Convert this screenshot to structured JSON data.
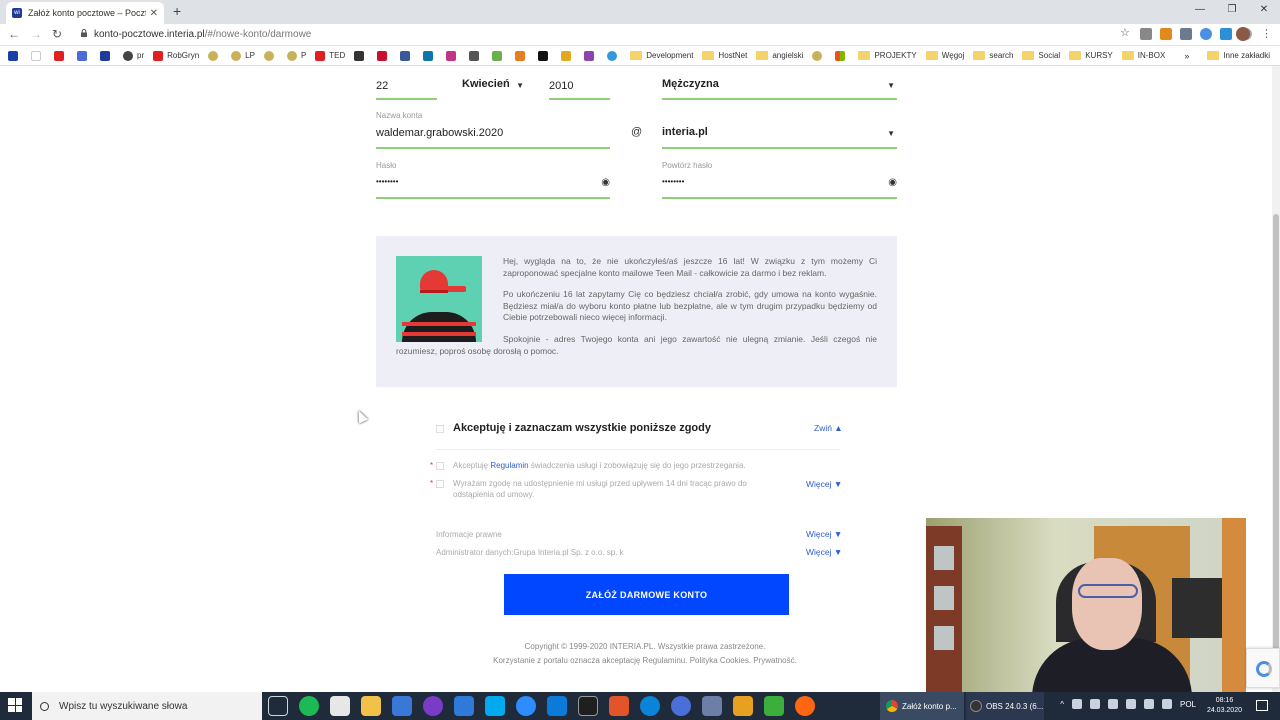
{
  "browser": {
    "tab_title": "Załóż konto pocztowe – Poczta w",
    "url_main": "konto-pocztowe.interia.pl",
    "url_path": "/#/nowe-konto/darmowe",
    "bookmarks": [
      "",
      "",
      "",
      "",
      "",
      "pr",
      "RobGryn",
      "",
      "LP",
      "",
      "P",
      "TED",
      "",
      "",
      "",
      "",
      "",
      "",
      "",
      "",
      "",
      "",
      "",
      ""
    ],
    "bookmark_folders": [
      "Development",
      "HostNet",
      "angielski",
      "",
      "PROJEKTY",
      "Węgoj",
      "search",
      "Social",
      "KURSY",
      "IN-BOX"
    ],
    "bookmarks_more": "»",
    "other_bookmarks": "Inne zakładki"
  },
  "form": {
    "day": "22",
    "month": "Kwiecień",
    "year": "2010",
    "gender": "Mężczyzna",
    "account_label": "Nazwa konta",
    "account_value": "waldemar.grabowski.2020",
    "at_sign": "@",
    "domain": "interia.pl",
    "password_label": "Hasło",
    "password_value": "••••••••",
    "repeat_label": "Powtórz hasło",
    "repeat_value": "••••••••"
  },
  "teen_notice": {
    "p1": "Hej, wygląda na to, że nie ukończyłeś/aś jeszcze 16 lat! W związku z tym możemy Ci zaproponować specjalne konto mailowe Teen Mail - całkowicie za darmo i bez reklam.",
    "p2": "Po ukończeniu 16 lat zapytamy Cię co będziesz chciał/a zrobić, gdy umowa na konto wygaśnie. Będziesz miał/a do wyboru konto płatne lub bezpłatne, ale w tym drugim przypadku będziemy od Ciebie potrzebowali nieco więcej informacji.",
    "p3": "Spokojnie - adres Twojego konta ani jego zawartość nie ulegną zmianie. Jeśli czegoś nie rozumiesz, poproś osobę dorosłą o pomoc."
  },
  "consents": {
    "accept_all": "Akceptuję i zaznaczam wszystkie poniższe zgody",
    "collapse": "Zwiń ▲",
    "req_mark": "*",
    "c1_pre": "Akceptuję ",
    "c1_link": "Regulamin",
    "c1_post": " świadczenia usługi i zobowiązuję się do jego przestrzegania.",
    "c2": "Wyrażam zgodę na udostępnienie mi usługi przed upływem 14 dni tracąc prawo do odstąpienia od umowy.",
    "more": "Więcej ▼",
    "legal_info": "Informacje prawne",
    "admin": "Administrator danych:Grupa Interia.pl Sp. z o.o. sp. k"
  },
  "submit_label": "ZAŁÓŻ DARMOWE KONTO",
  "footer": {
    "copyright": "Copyright © 1999-2020 INTERIA.PL. Wszystkie prawa zastrzeżone.",
    "terms": "Korzystanie z portalu oznacza akceptację Regulaminu. Polityka Cookies. Prywatność."
  },
  "taskbar": {
    "search_placeholder": "Wpisz tu wyszukiwane słowa",
    "chrome_item": "Załóż konto p...",
    "obs_item": "OBS 24.0.3 (6...",
    "lang": "POL",
    "time": "08:16",
    "date": "24.03.2020"
  },
  "colors": {
    "accent_blue": "#0047ff",
    "field_underline": "#8fd07b",
    "link_blue": "#2d5cd6"
  }
}
